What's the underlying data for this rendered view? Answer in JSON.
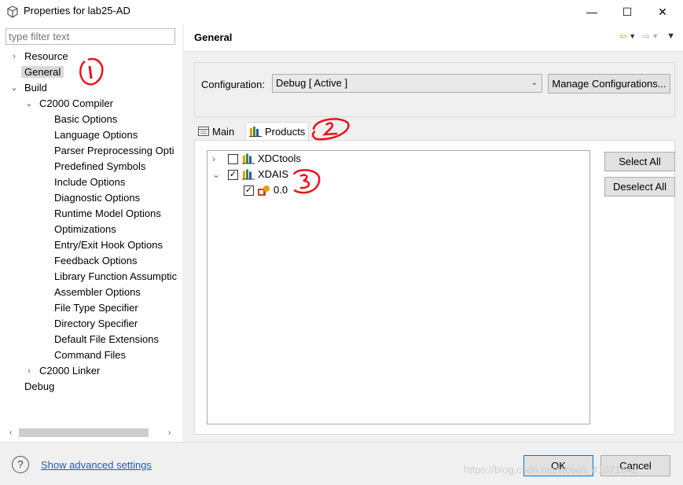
{
  "window": {
    "title": "Properties for lab25-AD",
    "minimize": "—",
    "maximize": "☐",
    "close": "✕"
  },
  "filter": {
    "placeholder": "type filter text"
  },
  "tree": {
    "resource": "Resource",
    "general": "General",
    "build": "Build",
    "c2000_compiler": "C2000 Compiler",
    "compiler_items": [
      "Basic Options",
      "Language Options",
      "Parser Preprocessing Opti",
      "Predefined Symbols",
      "Include Options",
      "Diagnostic Options",
      "Runtime Model Options",
      "Optimizations",
      "Entry/Exit Hook Options",
      "Feedback Options",
      "Library Function Assumptic",
      "Assembler Options",
      "File Type Specifier",
      "Directory Specifier",
      "Default File Extensions",
      "Command Files"
    ],
    "c2000_linker": "C2000 Linker",
    "debug": "Debug"
  },
  "page": {
    "title": "General",
    "config_label": "Configuration:",
    "config_value": "Debug  [ Active ]",
    "manage_button": "Manage Configurations...",
    "tabs": [
      {
        "label": "Main"
      },
      {
        "label": "Products"
      }
    ],
    "products": [
      {
        "label": "XDCtools",
        "checked": false,
        "expanded": false
      },
      {
        "label": "XDAIS",
        "checked": true,
        "expanded": true
      },
      {
        "label": "0.0",
        "checked": true
      }
    ],
    "select_all": "Select All",
    "deselect_all": "Deselect All"
  },
  "footer": {
    "help": "?",
    "advanced_link": "Show advanced settings",
    "ok": "OK",
    "cancel": "Cancel",
    "watermark": "https://blog.csdn.net/weixin_41071642"
  },
  "annotations": [
    "1",
    "2",
    "3"
  ],
  "colors": {
    "annotation": "#e8121b",
    "link": "#1a5fb4",
    "default_button_border": "#0078d7"
  }
}
